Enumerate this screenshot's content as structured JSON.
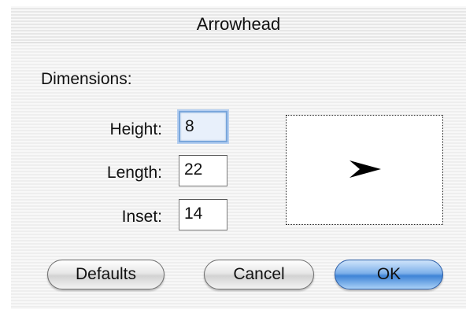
{
  "window": {
    "title": "Arrowhead"
  },
  "dimensions": {
    "label": "Dimensions:",
    "height": {
      "label": "Height:",
      "value": "8"
    },
    "length": {
      "label": "Length:",
      "value": "22"
    },
    "inset": {
      "label": "Inset:",
      "value": "14"
    }
  },
  "preview": {
    "icon": "arrowhead-preview-icon"
  },
  "buttons": {
    "defaults": "Defaults",
    "cancel": "Cancel",
    "ok": "OK"
  },
  "colors": {
    "default_button": "#5a97e0",
    "focus_ring": "#7aa7dc"
  }
}
